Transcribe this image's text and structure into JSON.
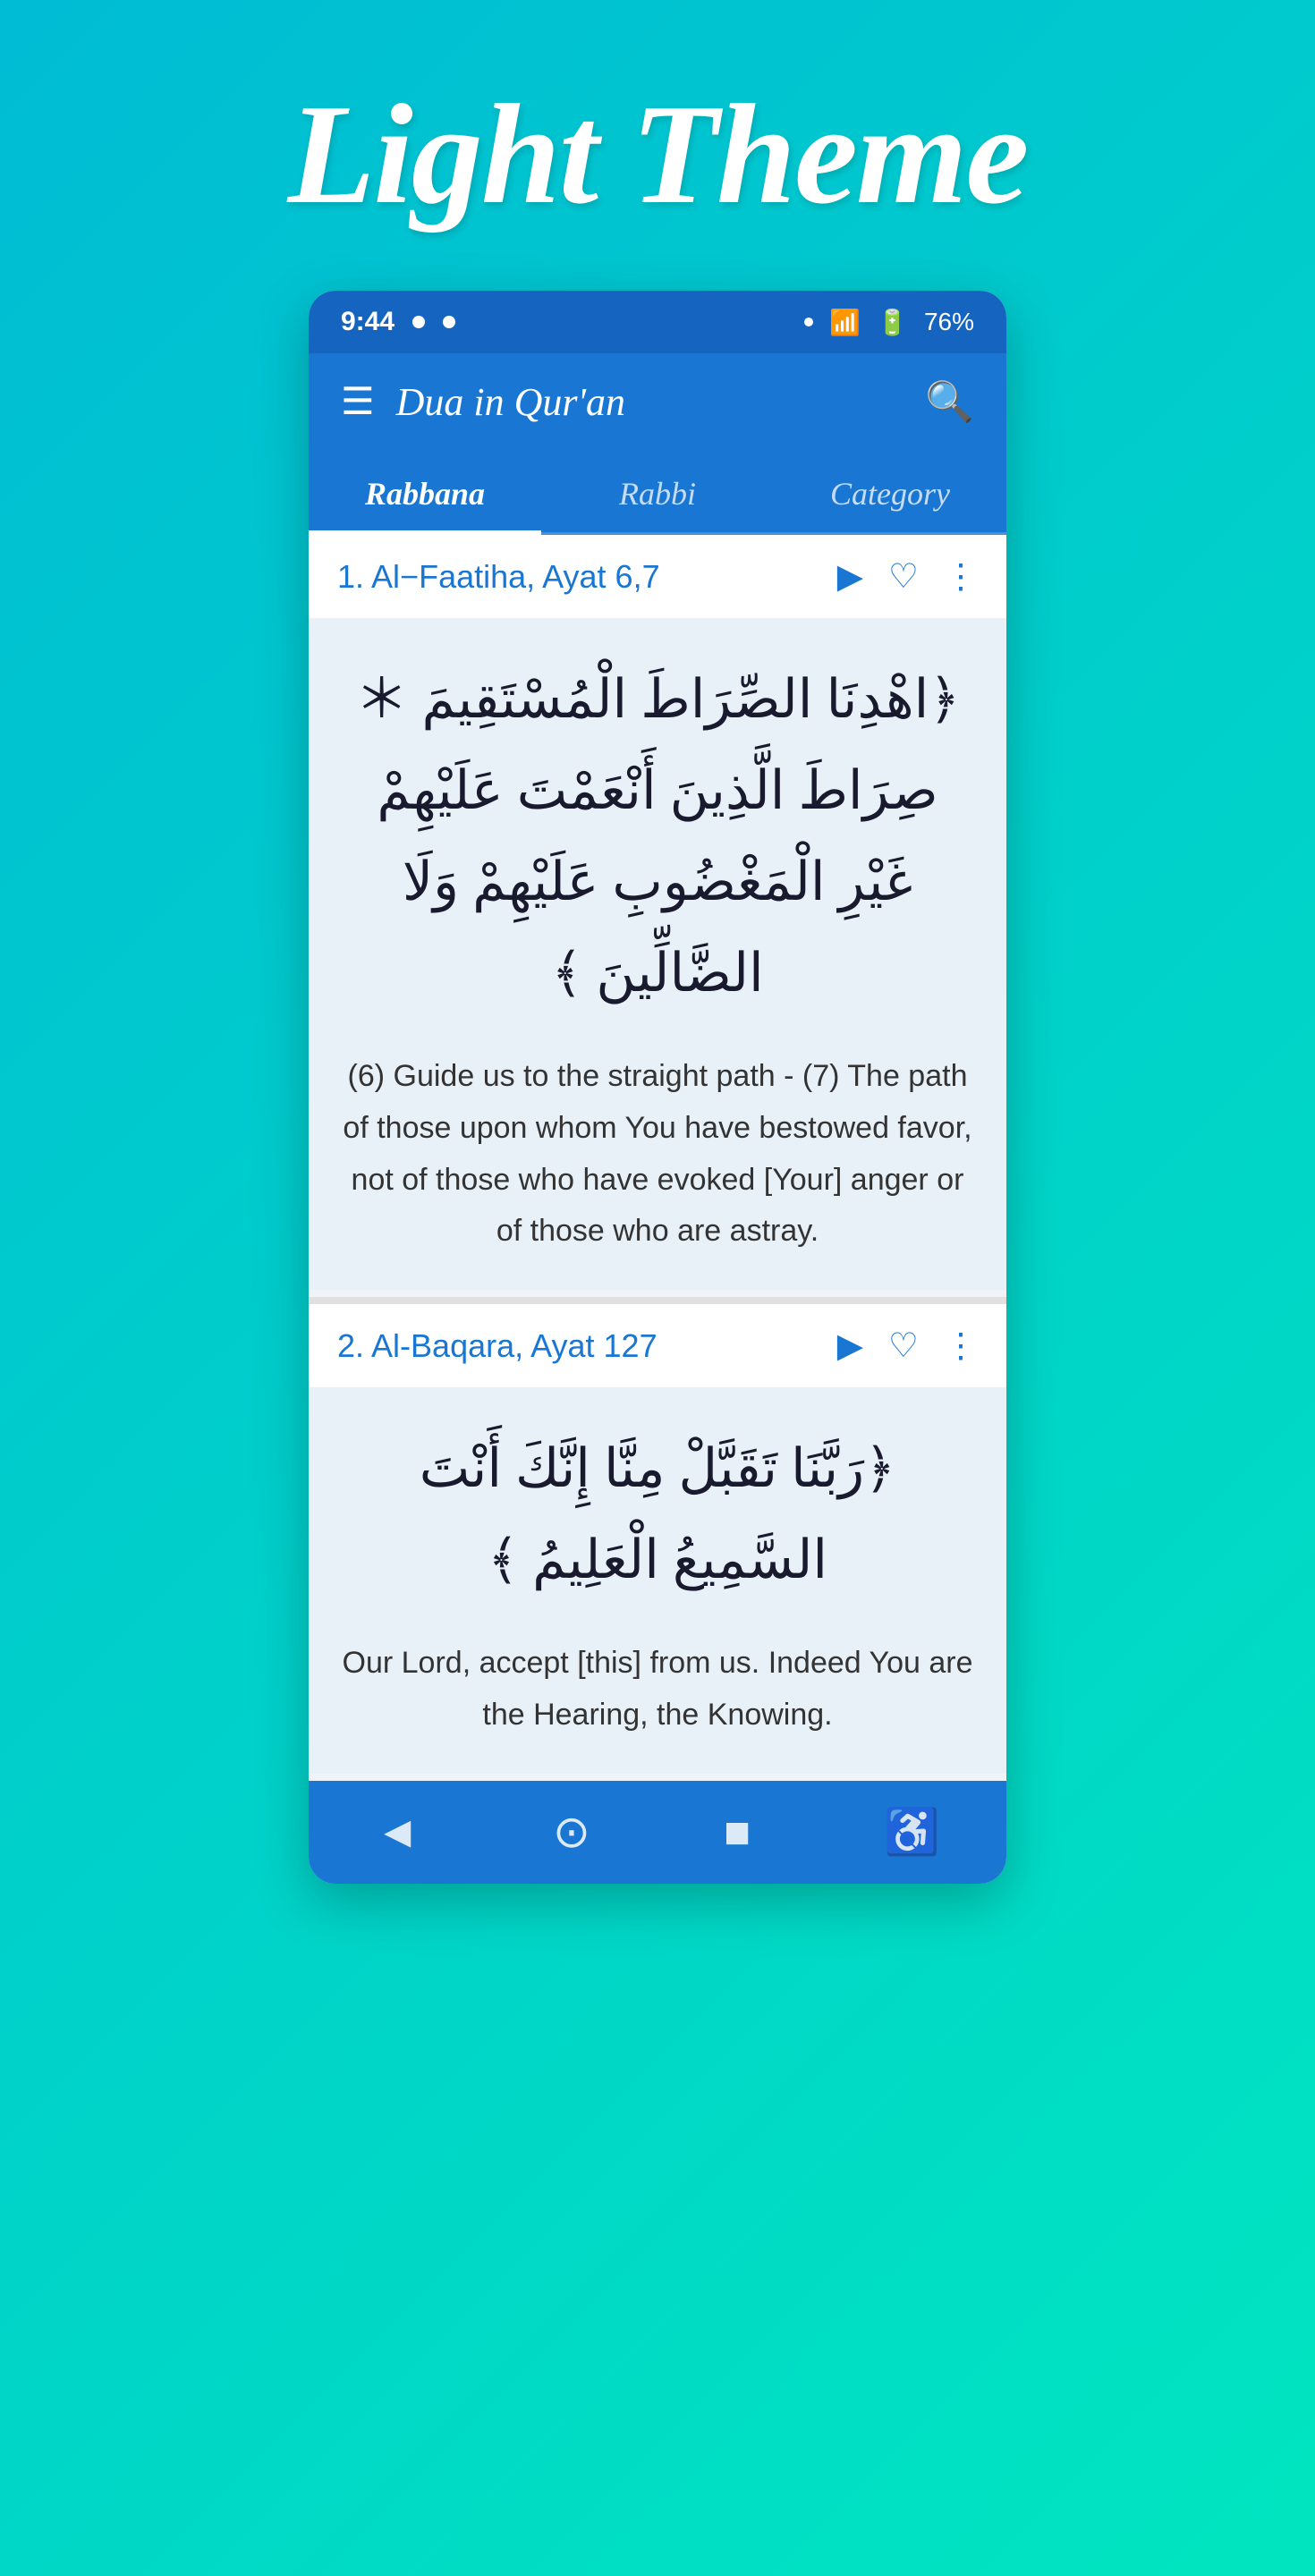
{
  "page_title": "Light Theme",
  "status_bar": {
    "time": "9:44",
    "battery": "76%"
  },
  "app_bar": {
    "title": "Dua in Qur'an"
  },
  "tabs": [
    {
      "label": "Rabbana",
      "active": true
    },
    {
      "label": "Rabbi",
      "active": false
    },
    {
      "label": "Category",
      "active": false
    }
  ],
  "duas": [
    {
      "id": 1,
      "title": "1. Al−Faatiha, Ayat 6,7",
      "arabic": "﴿اهْدِنَا الصِّرَاطَ الْمُسْتَقِيمَ ＊ صِرَاطَ الَّذِينَ أَنْعَمْتَ عَلَيْهِمْ غَيْرِ الْمَغْضُوبِ عَلَيْهِمْ وَلَا الضَّالِّينَ ﴾",
      "translation": "(6) Guide us to the straight path - (7) The path of those upon whom You have bestowed favor, not of those who have evoked [Your] anger or of those who are astray."
    },
    {
      "id": 2,
      "title": "2. Al-Baqara, Ayat 127",
      "arabic": "﴿رَبَّنَا تَقَبَّلْ مِنَّا إِنَّكَ أَنْتَ السَّمِيعُ الْعَلِيمُ ﴾",
      "translation": "Our Lord, accept [this] from us. Indeed You are the Hearing, the Knowing."
    }
  ],
  "bottom_nav": {
    "back_icon": "◄",
    "home_icon": "⊙",
    "recent_icon": "■",
    "access_icon": "♿"
  }
}
